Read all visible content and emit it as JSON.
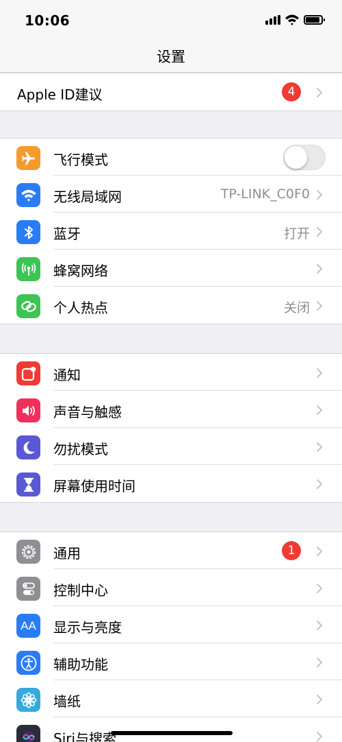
{
  "status": {
    "time": "10:06"
  },
  "nav": {
    "title": "设置"
  },
  "apple_id": {
    "label": "Apple ID建议",
    "badge": "4"
  },
  "group1": [
    {
      "label": "飞行模式",
      "icon": "airplane-icon",
      "color": "#f69a2c",
      "toggle_on": false
    },
    {
      "label": "无线局域网",
      "icon": "wifi-icon",
      "color": "#2a7cf5",
      "value": "TP-LINK_C0F0"
    },
    {
      "label": "蓝牙",
      "icon": "bluetooth-icon",
      "color": "#2a7cf5",
      "value": "打开"
    },
    {
      "label": "蜂窝网络",
      "icon": "cellular-antenna-icon",
      "color": "#3dc454"
    },
    {
      "label": "个人热点",
      "icon": "hotspot-link-icon",
      "color": "#3dc454",
      "value": "关闭"
    }
  ],
  "group2": [
    {
      "label": "通知",
      "icon": "notification-icon",
      "color": "#ee3b33"
    },
    {
      "label": "声音与触感",
      "icon": "speaker-icon",
      "color": "#f0305a"
    },
    {
      "label": "勿扰模式",
      "icon": "moon-icon",
      "color": "#5a58d4"
    },
    {
      "label": "屏幕使用时间",
      "icon": "hourglass-icon",
      "color": "#5a58d4"
    }
  ],
  "group3": [
    {
      "label": "通用",
      "icon": "gear-icon",
      "color": "#8e8e93",
      "badge": "1"
    },
    {
      "label": "控制中心",
      "icon": "switches-icon",
      "color": "#8e8e93"
    },
    {
      "label": "显示与亮度",
      "icon": "text-size-icon",
      "color": "#2a7cf5",
      "glyph": "AA"
    },
    {
      "label": "辅助功能",
      "icon": "accessibility-icon",
      "color": "#2a7cf5"
    },
    {
      "label": "墙纸",
      "icon": "flower-icon",
      "color": "#36aadc"
    },
    {
      "label": "Siri与搜索",
      "icon": "siri-icon",
      "color": "#2b2b3a"
    }
  ]
}
